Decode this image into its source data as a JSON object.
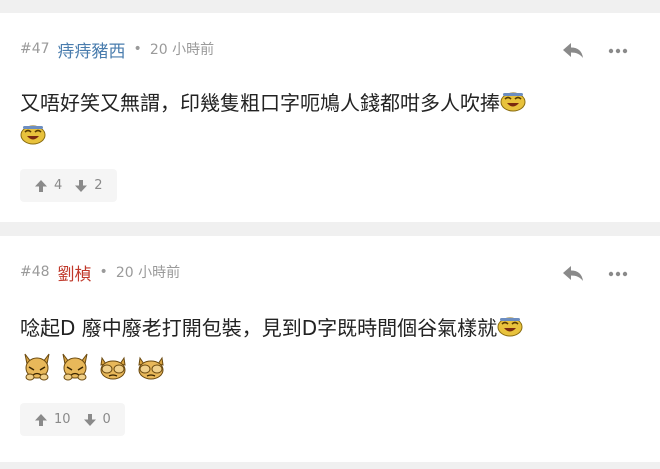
{
  "colors": {
    "author_default": "#4a7dae",
    "author_highlight": "#c0392b",
    "background": "#f0f0f0",
    "text": "#222222"
  },
  "posts": [
    {
      "floor": "#47",
      "author": "痔痔豬西",
      "separator": "•",
      "time": "20 小時前",
      "content_line1": "又唔好笑又無謂，印幾隻粗口字呃鳩人錢都咁多人吹捧",
      "emojis_line1": [
        "laughing-face-emoji"
      ],
      "emojis_line2": [
        "laughing-face-emoji"
      ],
      "upvotes": "4",
      "downvotes": "2"
    },
    {
      "floor": "#48",
      "author": "劉楨",
      "separator": "•",
      "time": "20 小時前",
      "content_line1": "唸起D 廢中廢老打開包裝，見到D字既時間個谷氣樣就",
      "emojis_line1": [
        "laughing-face-emoji"
      ],
      "emojis_line2": [
        "facepalm-dog-emoji",
        "facepalm-dog-emoji",
        "cover-face-dog-emoji",
        "cover-face-dog-emoji"
      ],
      "upvotes": "10",
      "downvotes": "0"
    }
  ]
}
